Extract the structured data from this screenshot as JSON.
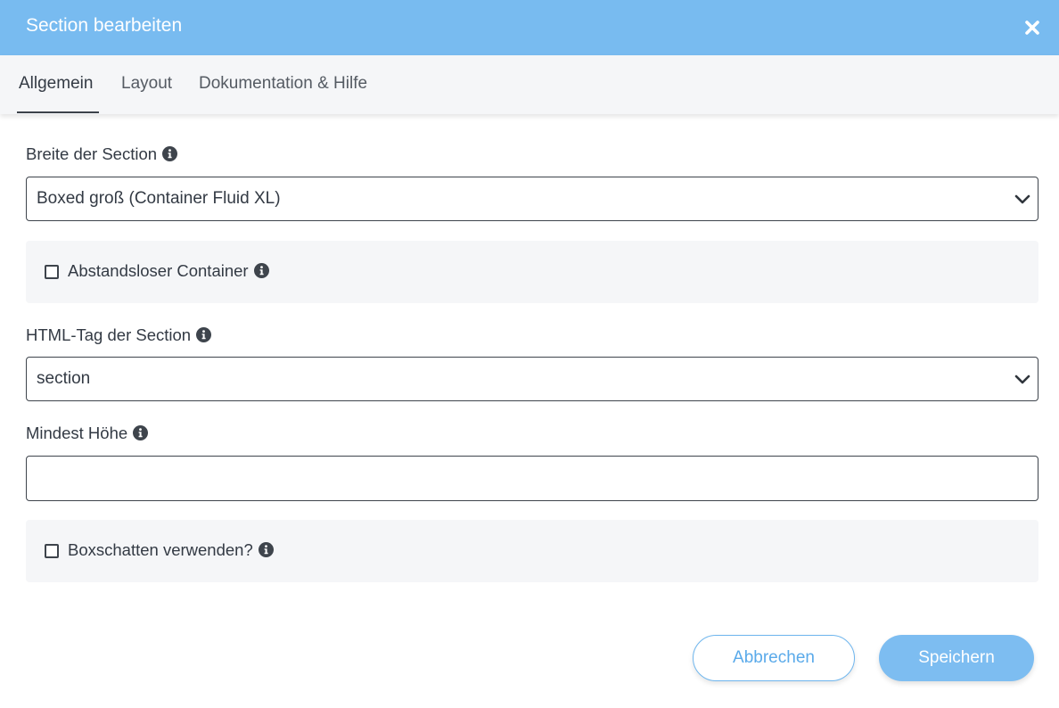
{
  "dialog": {
    "title": "Section bearbeiten",
    "close_icon": "close-icon"
  },
  "tabs": [
    {
      "label": "Allgemein",
      "active": true
    },
    {
      "label": "Layout",
      "active": false
    },
    {
      "label": "Dokumentation & Hilfe",
      "active": false
    }
  ],
  "fields": {
    "width": {
      "label": "Breite der Section",
      "value": "Boxed groß (Container Fluid XL)",
      "icon": "info-icon"
    },
    "no_gap": {
      "label": "Abstandsloser Container",
      "checked": false,
      "icon": "info-icon"
    },
    "html_tag": {
      "label": "HTML-Tag der Section",
      "value": "section",
      "icon": "info-icon"
    },
    "min_height": {
      "label": "Mindest Höhe",
      "value": "",
      "icon": "info-icon"
    },
    "box_shadow": {
      "label": "Boxschatten verwenden?",
      "checked": false,
      "icon": "info-icon"
    }
  },
  "footer": {
    "cancel_label": "Abbrechen",
    "save_label": "Speichern"
  },
  "colors": {
    "header_bg": "#78bbf0",
    "accent": "#5aaaea",
    "panel_bg": "#f5f6f8",
    "text": "#333a44"
  }
}
